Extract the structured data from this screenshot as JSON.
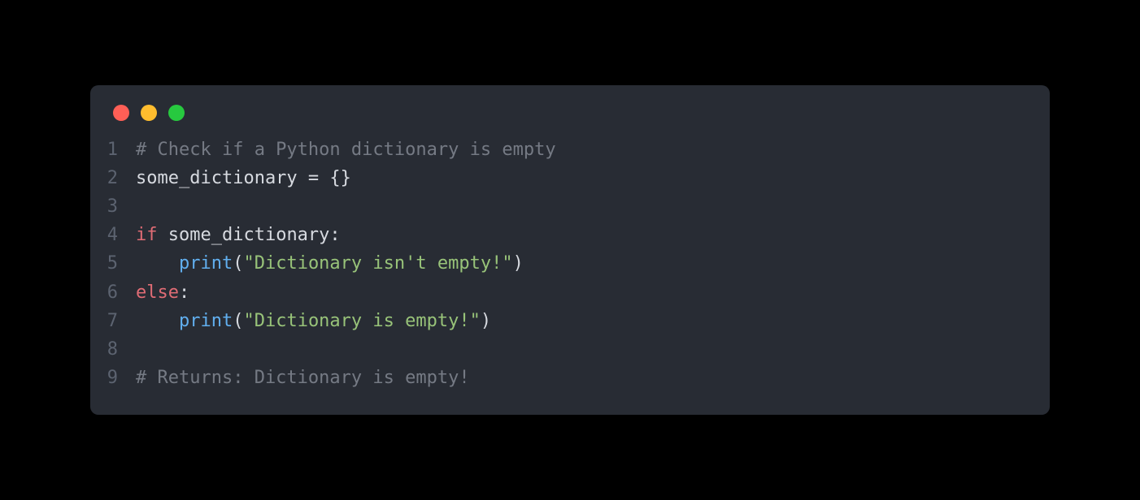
{
  "window": {
    "dots": {
      "red": "#ff5f56",
      "yellow": "#ffbd2e",
      "green": "#27c93f"
    }
  },
  "code": {
    "lines": [
      {
        "num": "1",
        "tokens": [
          {
            "cls": "t-comment",
            "text": "# Check if a Python dictionary is empty"
          }
        ]
      },
      {
        "num": "2",
        "tokens": [
          {
            "cls": "t-default",
            "text": "some_dictionary "
          },
          {
            "cls": "t-punct",
            "text": "="
          },
          {
            "cls": "t-default",
            "text": " "
          },
          {
            "cls": "t-punct",
            "text": "{}"
          }
        ]
      },
      {
        "num": "3",
        "tokens": [
          {
            "cls": "t-default",
            "text": ""
          }
        ]
      },
      {
        "num": "4",
        "tokens": [
          {
            "cls": "t-keyword",
            "text": "if"
          },
          {
            "cls": "t-default",
            "text": " some_dictionary"
          },
          {
            "cls": "t-punct",
            "text": ":"
          }
        ]
      },
      {
        "num": "5",
        "tokens": [
          {
            "cls": "t-default",
            "text": "    "
          },
          {
            "cls": "t-func",
            "text": "print"
          },
          {
            "cls": "t-punct",
            "text": "("
          },
          {
            "cls": "t-string",
            "text": "\"Dictionary isn't empty!\""
          },
          {
            "cls": "t-punct",
            "text": ")"
          }
        ]
      },
      {
        "num": "6",
        "tokens": [
          {
            "cls": "t-keyword",
            "text": "else"
          },
          {
            "cls": "t-punct",
            "text": ":"
          }
        ]
      },
      {
        "num": "7",
        "tokens": [
          {
            "cls": "t-default",
            "text": "    "
          },
          {
            "cls": "t-func",
            "text": "print"
          },
          {
            "cls": "t-punct",
            "text": "("
          },
          {
            "cls": "t-string",
            "text": "\"Dictionary is empty!\""
          },
          {
            "cls": "t-punct",
            "text": ")"
          }
        ]
      },
      {
        "num": "8",
        "tokens": [
          {
            "cls": "t-default",
            "text": ""
          }
        ]
      },
      {
        "num": "9",
        "tokens": [
          {
            "cls": "t-comment",
            "text": "# Returns: Dictionary is empty!"
          }
        ]
      }
    ]
  }
}
